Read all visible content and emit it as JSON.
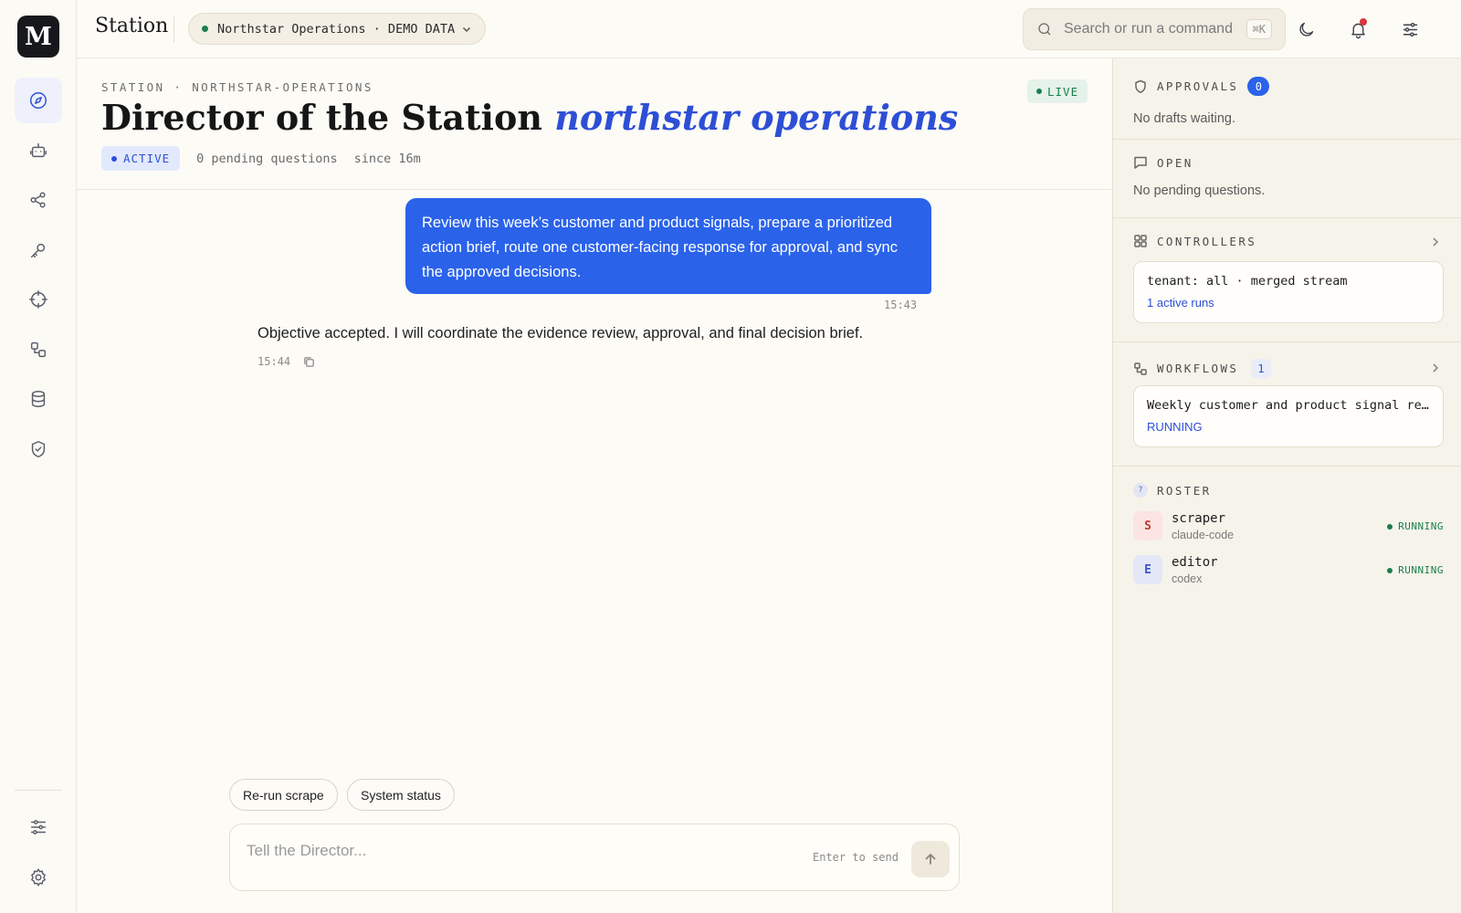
{
  "app": {
    "logo_letter": "M",
    "brand": "Station",
    "tenant": "Northstar Operations · DEMO DATA"
  },
  "search": {
    "placeholder": "Search or run a command",
    "shortcut": "⌘K"
  },
  "header": {
    "breadcrumb": "STATION · NORTHSTAR-OPERATIONS",
    "title_main": "Director of the Station",
    "title_accent": "northstar operations",
    "live_label": "LIVE",
    "status_badge": "ACTIVE",
    "pending": "0 pending questions",
    "since": "since 16m"
  },
  "chat": {
    "user_message": "Review this week’s customer and product signals, prepare a prioritized action brief, route one customer-facing response for approval, and sync the approved decisions.",
    "user_time": "15:43",
    "agent_message": "Objective accepted. I will coordinate the evidence review, approval, and final decision brief.",
    "agent_time": "15:44"
  },
  "quick_actions": [
    "Re-run scrape",
    "System status"
  ],
  "composer": {
    "placeholder": "Tell the Director...",
    "hint": "Enter to send"
  },
  "panel": {
    "approvals": {
      "label": "APPROVALS",
      "count": "0",
      "empty": "No drafts waiting."
    },
    "open": {
      "label": "OPEN",
      "empty": "No pending questions."
    },
    "controllers": {
      "label": "CONTROLLERS",
      "card_title": "tenant: all · merged stream",
      "card_sub": "1 active runs"
    },
    "workflows": {
      "label": "WORKFLOWS",
      "count": "1",
      "card_title": "Weekly customer and product signal review",
      "card_status": "RUNNING"
    },
    "roster": {
      "label": "ROSTER",
      "icon_glyph": "?",
      "agents": [
        {
          "initial": "S",
          "name": "scraper",
          "runtime": "claude-code",
          "status": "RUNNING"
        },
        {
          "initial": "E",
          "name": "editor",
          "runtime": "codex",
          "status": "RUNNING"
        }
      ]
    }
  },
  "colors": {
    "accent": "#2d4fd6",
    "bubble": "#2a62ea",
    "success": "#1a7f4b",
    "alert": "#d9363e"
  }
}
